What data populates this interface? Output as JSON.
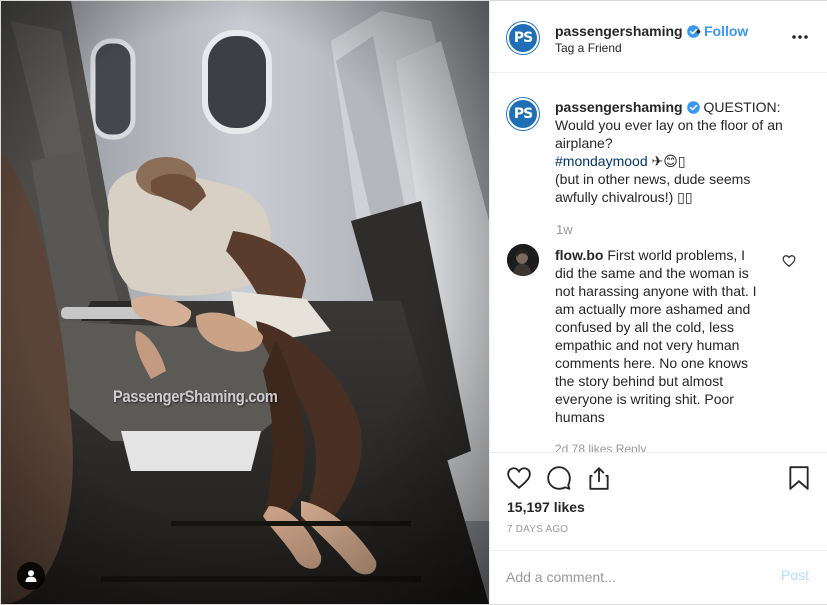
{
  "post": {
    "watermark": "PassengerShaming.com"
  },
  "header": {
    "avatar_text": "PS",
    "username": "passengershaming",
    "dot": "•",
    "follow_label": "Follow",
    "location": "Tag a Friend"
  },
  "caption": {
    "username": "passengershaming",
    "text_1": "QUESTION: Would you ever lay on the floor of an airplane?",
    "hashtag": "#mondaymood",
    "emojis": "✈😊▯",
    "text_2": "(but in other news, dude seems awfully chivalrous!) ▯▯",
    "time": "1w"
  },
  "comment": {
    "username": "flow.bo",
    "text": "First world problems, I did the same and the woman is not harassing anyone with that. I am actually more ashamed and confused by all the cold, less empathic and not very human comments here. No one knows the story behind but almost everyone is writing shit. Poor humans",
    "meta": "2d   78 likes   Reply"
  },
  "actions": {
    "likes": "15,197 likes",
    "posted": "7 DAYS AGO"
  },
  "add_comment": {
    "placeholder": "Add a comment...",
    "post_label": "Post"
  },
  "colors": {
    "link": "#3897f0",
    "hashtag": "#003569",
    "brand_avatar": "#1e6fb5",
    "muted": "#999999"
  },
  "icons": [
    "verified-badge-icon",
    "more-options-icon",
    "heart-icon",
    "comment-icon",
    "share-icon",
    "bookmark-icon",
    "user-tag-icon"
  ]
}
